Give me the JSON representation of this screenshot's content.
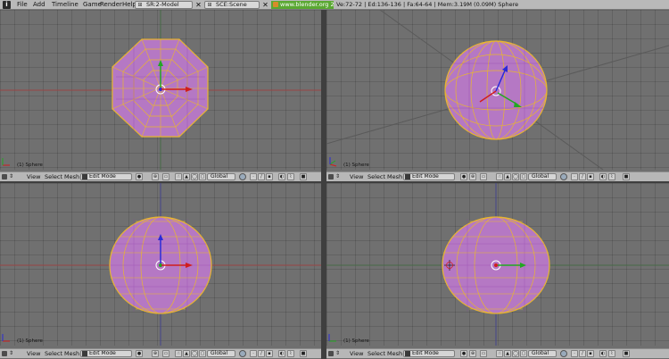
{
  "topbar": {
    "logo": "i",
    "menus": [
      "File",
      "Add",
      "Timeline",
      "Game",
      "Render",
      "Help"
    ],
    "screen": "SR:2-Model",
    "scene": "SCE:Scene",
    "url": "www.blender.org 249.2",
    "stats": "Ve:72-72 | Ed:136-136 | Fa:64-64 | Mem:3.19M (0.09M) Sphere"
  },
  "viewports": [
    {
      "label": "(1) Sphere"
    },
    {
      "label": "(1) Sphere"
    },
    {
      "label": "(1) Sphere"
    },
    {
      "label": "(1) Sphere"
    }
  ],
  "header": {
    "view": "View",
    "select": "Select",
    "mesh": "Mesh",
    "mode": "Edit Mode",
    "orientation": "Global"
  },
  "colors": {
    "mesh_fill": "#b578c4",
    "mesh_edge": "#e8b530",
    "x_axis": "#d11d1d",
    "y_axis": "#22a722",
    "z_axis": "#2a2ad8"
  }
}
